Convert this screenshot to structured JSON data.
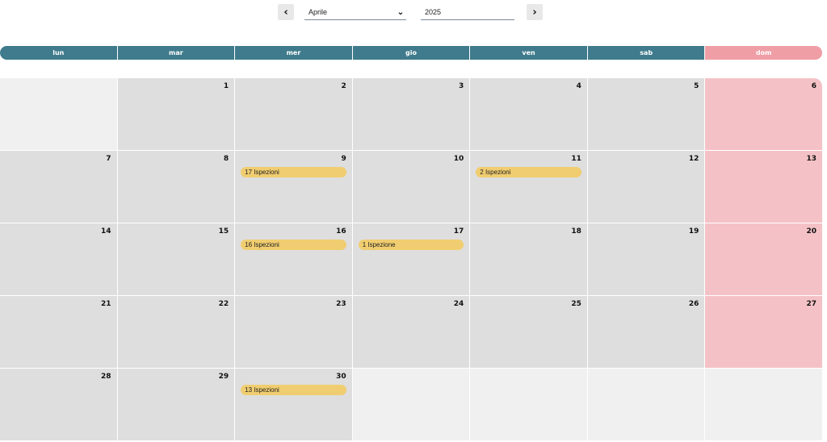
{
  "nav": {
    "prev_glyph": "‹",
    "next_glyph": "›",
    "month_value": "Aprile",
    "year_value": "2025",
    "dropdown_icon": "chevron-down-icon"
  },
  "weekdays": [
    "lun",
    "mar",
    "mer",
    "gio",
    "ven",
    "sab",
    "dom"
  ],
  "days": [
    "1",
    "2",
    "3",
    "4",
    "5",
    "6",
    "7",
    "8",
    "9",
    "10",
    "11",
    "12",
    "13",
    "14",
    "15",
    "16",
    "17",
    "18",
    "19",
    "20",
    "21",
    "22",
    "23",
    "24",
    "25",
    "26",
    "27",
    "28",
    "29",
    "30"
  ],
  "events": {
    "d9": "17 Ispezioni",
    "d11": "2 Ispezioni",
    "d16": "16 Ispezioni",
    "d17": "1 Ispezione",
    "d30": "13 Ispezioni"
  },
  "colors": {
    "header": "#3f7b8c",
    "sunday_header": "#ef9ea5",
    "sunday_cell": "#f4c2c6",
    "day_cell": "#dedede",
    "empty_cell": "#f0f0f0",
    "event_pill": "#f0cd70"
  }
}
